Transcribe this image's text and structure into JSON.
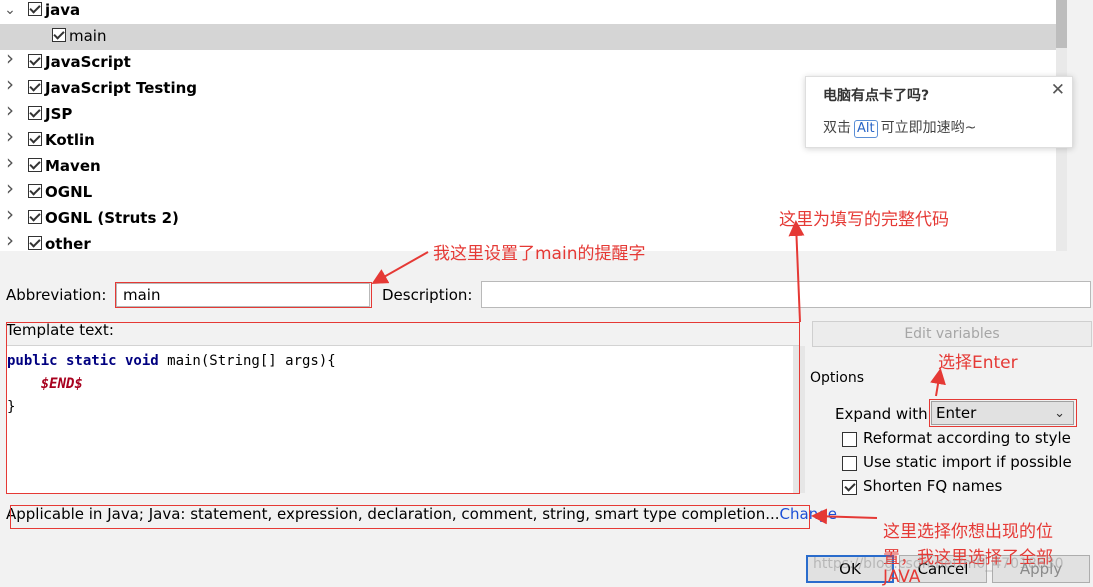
{
  "tree": {
    "items": [
      {
        "label": "java",
        "expanded": true,
        "checked": true,
        "bold": true
      },
      {
        "label": "main",
        "checked": true,
        "bold": false,
        "selected": true,
        "child": true
      },
      {
        "label": "JavaScript",
        "checked": true,
        "bold": true
      },
      {
        "label": "JavaScript Testing",
        "checked": true,
        "bold": true
      },
      {
        "label": "JSP",
        "checked": true,
        "bold": true
      },
      {
        "label": "Kotlin",
        "checked": true,
        "bold": true
      },
      {
        "label": "Maven",
        "checked": true,
        "bold": true
      },
      {
        "label": "OGNL",
        "checked": true,
        "bold": true
      },
      {
        "label": "OGNL (Struts 2)",
        "checked": true,
        "bold": true
      },
      {
        "label": "other",
        "checked": true,
        "bold": true
      }
    ]
  },
  "editor": {
    "abbreviation_label": "Abbreviation:",
    "abbreviation_value": "main",
    "description_label": "Description:",
    "description_value": "",
    "template_label": "Template text:",
    "code_line1_kw": "public static void",
    "code_line1_rest": " main(String[] args){",
    "code_line2_var": "$END$",
    "code_line3": "}",
    "edit_variables": "Edit variables",
    "options_label": "Options",
    "expand_label": "Expand with",
    "expand_value": "Enter",
    "options": [
      {
        "label": "Reformat according to style",
        "checked": false
      },
      {
        "label": "Use static import if possible",
        "checked": false
      },
      {
        "label": "Shorten FQ names",
        "checked": true
      }
    ],
    "applicable_text": "Applicable in Java; Java: statement, expression, declaration, comment, string, smart type completion...",
    "change_link": "Change"
  },
  "buttons": {
    "ok": "OK",
    "cancel": "Cancel",
    "apply": "Apply"
  },
  "notification": {
    "title": "电脑有点卡了吗?",
    "close": "✕",
    "body_prefix": "双击",
    "key": "Alt",
    "body_suffix": "可立即加速哟~"
  },
  "annotations": {
    "abbrev_note": "我这里设置了main的提醒字",
    "template_note": "这里为填写的完整代码",
    "expand_note": "选择Enter",
    "applicable_note_line1": "这里选择你想出现的位",
    "applicable_note_line2": "置，我这里选择了全部",
    "applicable_note_line3": "JAVA"
  },
  "watermark": "https://blog.csdn.net/m0_47018630",
  "colors": {
    "annotation_red": "#e53935",
    "link_blue": "#1c4fd6",
    "keyword_navy": "#000080",
    "template_var": "#a8001e"
  }
}
